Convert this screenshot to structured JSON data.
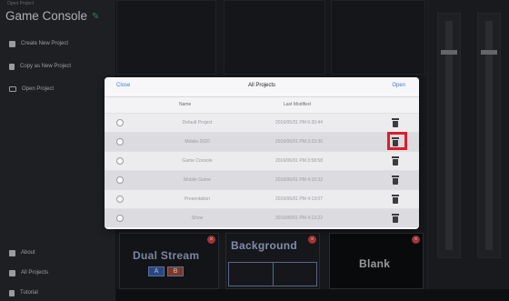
{
  "sidebar": {
    "small_label": "Open Project",
    "project_title": "Game Console",
    "pencil_icon": "pencil-icon",
    "menu_top": [
      {
        "label": "Create New Project",
        "icon": "document-icon"
      },
      {
        "label": "Copy as New Project",
        "icon": "copy-icon"
      },
      {
        "label": "Open Project",
        "icon": "folder-icon"
      }
    ],
    "menu_bottom": [
      {
        "label": "About",
        "icon": "info-icon"
      },
      {
        "label": "All Projects",
        "icon": "projects-icon"
      },
      {
        "label": "Tutorial",
        "icon": "tutorial-icon"
      }
    ]
  },
  "thumbnails": [
    {
      "title": "Dual Stream",
      "badges": [
        "A",
        "B"
      ]
    },
    {
      "title": "Background"
    },
    {
      "title": "Blank"
    }
  ],
  "modal": {
    "close_label": "Close",
    "title": "All Projects",
    "open_label": "Open",
    "columns": {
      "name": "Name",
      "modified": "Last Modified"
    },
    "rows": [
      {
        "name": "Default Project",
        "modified": "2016/05/31 PM 6:30:44",
        "highlighted": false
      },
      {
        "name": "Mobile 2020",
        "modified": "2016/06/01 PM 3:23:30",
        "highlighted": true
      },
      {
        "name": "Game Console",
        "modified": "2016/06/01 PM 3:58:58",
        "highlighted": false
      },
      {
        "name": "Mobile Game",
        "modified": "2016/06/01 PM 4:10:32",
        "highlighted": false
      },
      {
        "name": "Presentation",
        "modified": "2016/06/01 PM 4:13:07",
        "highlighted": false
      },
      {
        "name": "Show",
        "modified": "2016/06/01 PM 4:13:22",
        "highlighted": false
      }
    ]
  },
  "colors": {
    "accent": "#3d7bd6",
    "highlight": "#e01c2a",
    "badge": "#e04848"
  }
}
